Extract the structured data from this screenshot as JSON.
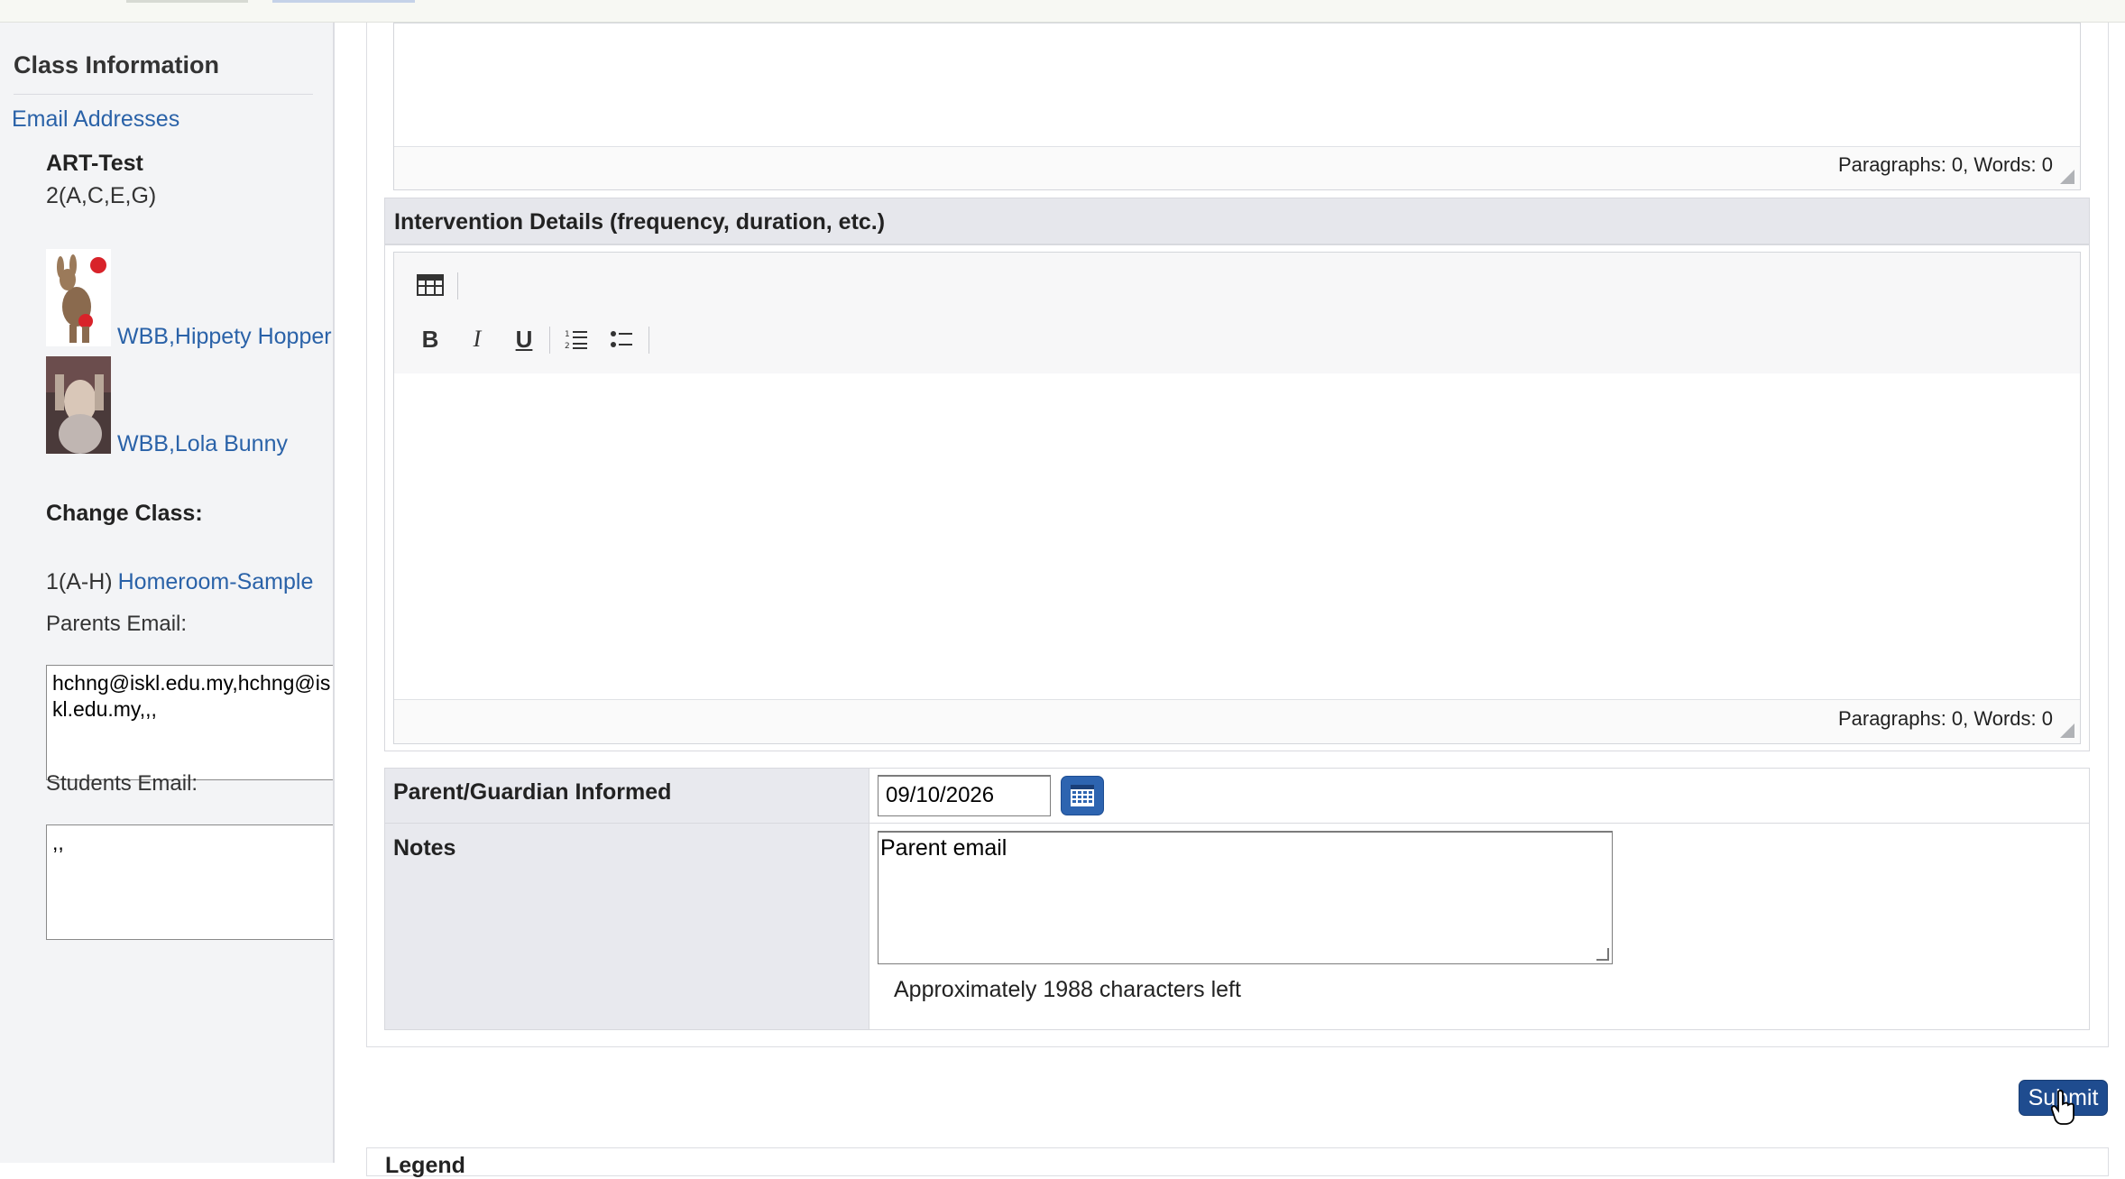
{
  "sidebar": {
    "title": "Class Information",
    "email_link": "Email Addresses",
    "class_name": "ART-Test",
    "class_period": "2(A,C,E,G)",
    "students": [
      {
        "name": "WBB,Hippety Hopper"
      },
      {
        "name": "WBB,Lola Bunny"
      }
    ],
    "change_class_label": "Change Class:",
    "homeroom_period": "1(A-H)",
    "homeroom_link": "Homeroom-Sample",
    "parents_email_label": "Parents Email:",
    "parents_email_value": "hchng@iskl.edu.my,hchng@iskl.edu.my,,,",
    "students_email_label": "Students Email:",
    "students_email_value": ",,"
  },
  "editor_top": {
    "status": "Paragraphs: 0, Words: 0"
  },
  "intervention": {
    "heading": "Intervention Details (frequency, duration, etc.)",
    "status": "Paragraphs: 0, Words: 0",
    "toolbar": {
      "bold": "B",
      "italic": "I",
      "underline": "U"
    }
  },
  "form": {
    "parent_informed_label": "Parent/Guardian Informed",
    "date_value": "09/10/2026",
    "notes_label": "Notes",
    "notes_value": "Parent email",
    "chars_left": "Approximately 1988 characters left"
  },
  "submit_label": "Submit",
  "bottom_panel_title": "Legend"
}
